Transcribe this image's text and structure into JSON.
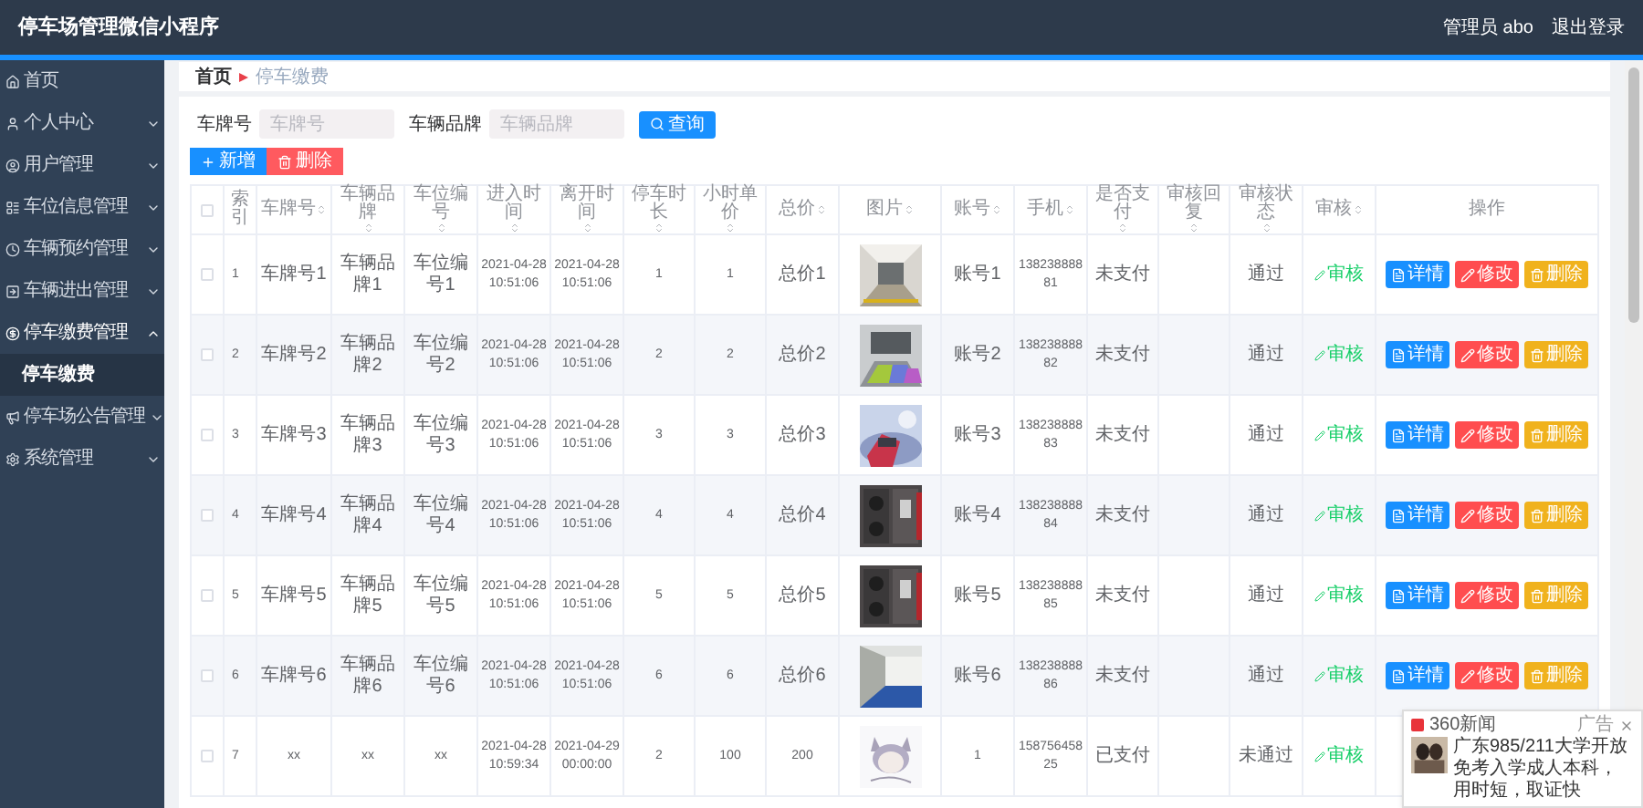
{
  "header": {
    "title": "停车场管理微信小程序",
    "user": "管理员 abo",
    "logout": "退出登录"
  },
  "sidebar": {
    "items": [
      {
        "label": "首页",
        "expanded": false,
        "has_caret": false
      },
      {
        "label": "个人中心",
        "expanded": false,
        "has_caret": true
      },
      {
        "label": "用户管理",
        "expanded": false,
        "has_caret": true
      },
      {
        "label": "车位信息管理",
        "expanded": false,
        "has_caret": true
      },
      {
        "label": "车辆预约管理",
        "expanded": false,
        "has_caret": true
      },
      {
        "label": "车辆进出管理",
        "expanded": false,
        "has_caret": true
      },
      {
        "label": "停车缴费管理",
        "expanded": true,
        "has_caret": true,
        "children": [
          {
            "label": "停车缴费",
            "selected": true
          }
        ]
      },
      {
        "label": "停车场公告管理",
        "expanded": false,
        "has_caret": true
      },
      {
        "label": "系统管理",
        "expanded": false,
        "has_caret": true
      }
    ]
  },
  "breadcrumb": [
    "首页",
    "停车缴费"
  ],
  "search": {
    "fields": [
      {
        "label": "车牌号",
        "placeholder": "车牌号"
      },
      {
        "label": "车辆品牌",
        "placeholder": "车辆品牌"
      }
    ],
    "button": "查询"
  },
  "actions": [
    {
      "label": "新增",
      "kind": "add"
    },
    {
      "label": "删除",
      "kind": "delete"
    }
  ],
  "table": {
    "all_checked": false,
    "columns": [
      {
        "label": "索引",
        "sortable": false,
        "kind": "text"
      },
      {
        "label": "车牌号",
        "sortable": true,
        "kind": "text"
      },
      {
        "label": "车辆品牌",
        "sortable": true,
        "kind": "text"
      },
      {
        "label": "车位编号",
        "sortable": true,
        "kind": "text"
      },
      {
        "label": "进入时间",
        "sortable": true,
        "kind": "text"
      },
      {
        "label": "离开时间",
        "sortable": true,
        "kind": "text"
      },
      {
        "label": "停车时长",
        "sortable": true,
        "kind": "text"
      },
      {
        "label": "小时单价",
        "sortable": true,
        "kind": "text"
      },
      {
        "label": "总价",
        "sortable": true,
        "kind": "text"
      },
      {
        "label": "图片",
        "sortable": true,
        "kind": "picture"
      },
      {
        "label": "账号",
        "sortable": true,
        "kind": "text"
      },
      {
        "label": "手机",
        "sortable": true,
        "kind": "text"
      },
      {
        "label": "是否支付",
        "sortable": true,
        "kind": "text"
      },
      {
        "label": "审核回复",
        "sortable": true,
        "kind": "text"
      },
      {
        "label": "审核状态",
        "sortable": true,
        "kind": "text"
      },
      {
        "label": "审核",
        "sortable": true,
        "kind": "review"
      },
      {
        "label": "操作",
        "sortable": false,
        "kind": "actions"
      }
    ],
    "rows": [
      {
        "checked": false,
        "cells": [
          "1",
          "车牌号1",
          "车辆品牌1",
          "车位编号1",
          "2021-04-28 10:51:06",
          "2021-04-28 10:51:06",
          "1",
          "1",
          "总价1",
          {
            "kind": "picture"
          },
          "账号1",
          "13823888881",
          "未支付",
          "",
          "通过",
          "审核",
          [
            {
              "label": "详情",
              "kind": "view"
            },
            {
              "label": "修改",
              "kind": "edit"
            },
            {
              "label": "删除",
              "kind": "delete"
            }
          ]
        ]
      },
      {
        "checked": false,
        "cells": [
          "2",
          "车牌号2",
          "车辆品牌2",
          "车位编号2",
          "2021-04-28 10:51:06",
          "2021-04-28 10:51:06",
          "2",
          "2",
          "总价2",
          {
            "kind": "picture"
          },
          "账号2",
          "13823888882",
          "未支付",
          "",
          "通过",
          "审核",
          [
            {
              "label": "详情",
              "kind": "view"
            },
            {
              "label": "修改",
              "kind": "edit"
            },
            {
              "label": "删除",
              "kind": "delete"
            }
          ]
        ]
      },
      {
        "checked": false,
        "cells": [
          "3",
          "车牌号3",
          "车辆品牌3",
          "车位编号3",
          "2021-04-28 10:51:06",
          "2021-04-28 10:51:06",
          "3",
          "3",
          "总价3",
          {
            "kind": "picture"
          },
          "账号3",
          "13823888883",
          "未支付",
          "",
          "通过",
          "审核",
          [
            {
              "label": "详情",
              "kind": "view"
            },
            {
              "label": "修改",
              "kind": "edit"
            },
            {
              "label": "删除",
              "kind": "delete"
            }
          ]
        ]
      },
      {
        "checked": false,
        "cells": [
          "4",
          "车牌号4",
          "车辆品牌4",
          "车位编号4",
          "2021-04-28 10:51:06",
          "2021-04-28 10:51:06",
          "4",
          "4",
          "总价4",
          {
            "kind": "picture"
          },
          "账号4",
          "13823888884",
          "未支付",
          "",
          "通过",
          "审核",
          [
            {
              "label": "详情",
              "kind": "view"
            },
            {
              "label": "修改",
              "kind": "edit"
            },
            {
              "label": "删除",
              "kind": "delete"
            }
          ]
        ]
      },
      {
        "checked": false,
        "cells": [
          "5",
          "车牌号5",
          "车辆品牌5",
          "车位编号5",
          "2021-04-28 10:51:06",
          "2021-04-28 10:51:06",
          "5",
          "5",
          "总价5",
          {
            "kind": "picture"
          },
          "账号5",
          "13823888885",
          "未支付",
          "",
          "通过",
          "审核",
          [
            {
              "label": "详情",
              "kind": "view"
            },
            {
              "label": "修改",
              "kind": "edit"
            },
            {
              "label": "删除",
              "kind": "delete"
            }
          ]
        ]
      },
      {
        "checked": false,
        "cells": [
          "6",
          "车牌号6",
          "车辆品牌6",
          "车位编号6",
          "2021-04-28 10:51:06",
          "2021-04-28 10:51:06",
          "6",
          "6",
          "总价6",
          {
            "kind": "picture"
          },
          "账号6",
          "13823888886",
          "未支付",
          "",
          "通过",
          "审核",
          [
            {
              "label": "详情",
              "kind": "view"
            },
            {
              "label": "修改",
              "kind": "edit"
            },
            {
              "label": "删除",
              "kind": "delete"
            }
          ]
        ]
      },
      {
        "checked": false,
        "cells": [
          "7",
          "xx",
          "xx",
          "xx",
          "2021-04-28 10:59:34",
          "2021-04-29 00:00:00",
          "2",
          "100",
          "200",
          {
            "kind": "picture"
          },
          "1",
          "15875645825",
          "已支付",
          "",
          "未通过",
          "审核"
        ]
      }
    ]
  },
  "notification": {
    "source": "360新闻",
    "text": "广东985/211大学开放免考入学成人本科，用时短，取证快",
    "tag": "广告"
  }
}
